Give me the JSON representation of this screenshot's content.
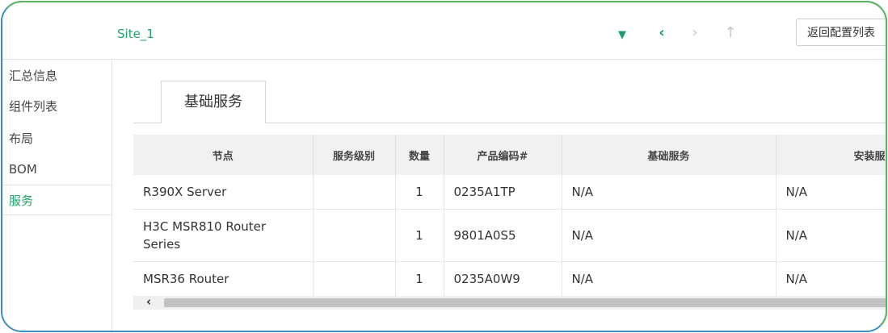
{
  "header": {
    "site_name": "Site_1",
    "return_label": "返回配置列表",
    "icons": [
      "dropdown-triangle-icon",
      "back-arrow-icon",
      "forward-arrow-icon",
      "up-arrow-icon"
    ]
  },
  "sidebar": {
    "items": [
      {
        "label": "汇总信息"
      },
      {
        "label": "组件列表"
      },
      {
        "label": "布局"
      },
      {
        "label": "BOM"
      },
      {
        "label": "服务",
        "active": true
      }
    ]
  },
  "tabs": [
    {
      "label": "基础服务",
      "active": true
    }
  ],
  "table": {
    "columns": [
      "节点",
      "服务级别",
      "数量",
      "产品编码#",
      "基础服务",
      "安装服"
    ],
    "rows": [
      {
        "node": "R390X Server",
        "level": "",
        "qty": "1",
        "code": "0235A1TP",
        "basic": "N/A",
        "install": "N/A"
      },
      {
        "node": "H3C MSR810 Router Series",
        "level": "",
        "qty": "1",
        "code": "9801A0S5",
        "basic": "N/A",
        "install": "N/A"
      },
      {
        "node": "MSR36 Router",
        "level": "",
        "qty": "1",
        "code": "0235A0W9",
        "basic": "N/A",
        "install": "N/A"
      }
    ]
  },
  "colors": {
    "accent": "#21a46a",
    "frame_border": "#3a8fc0"
  }
}
